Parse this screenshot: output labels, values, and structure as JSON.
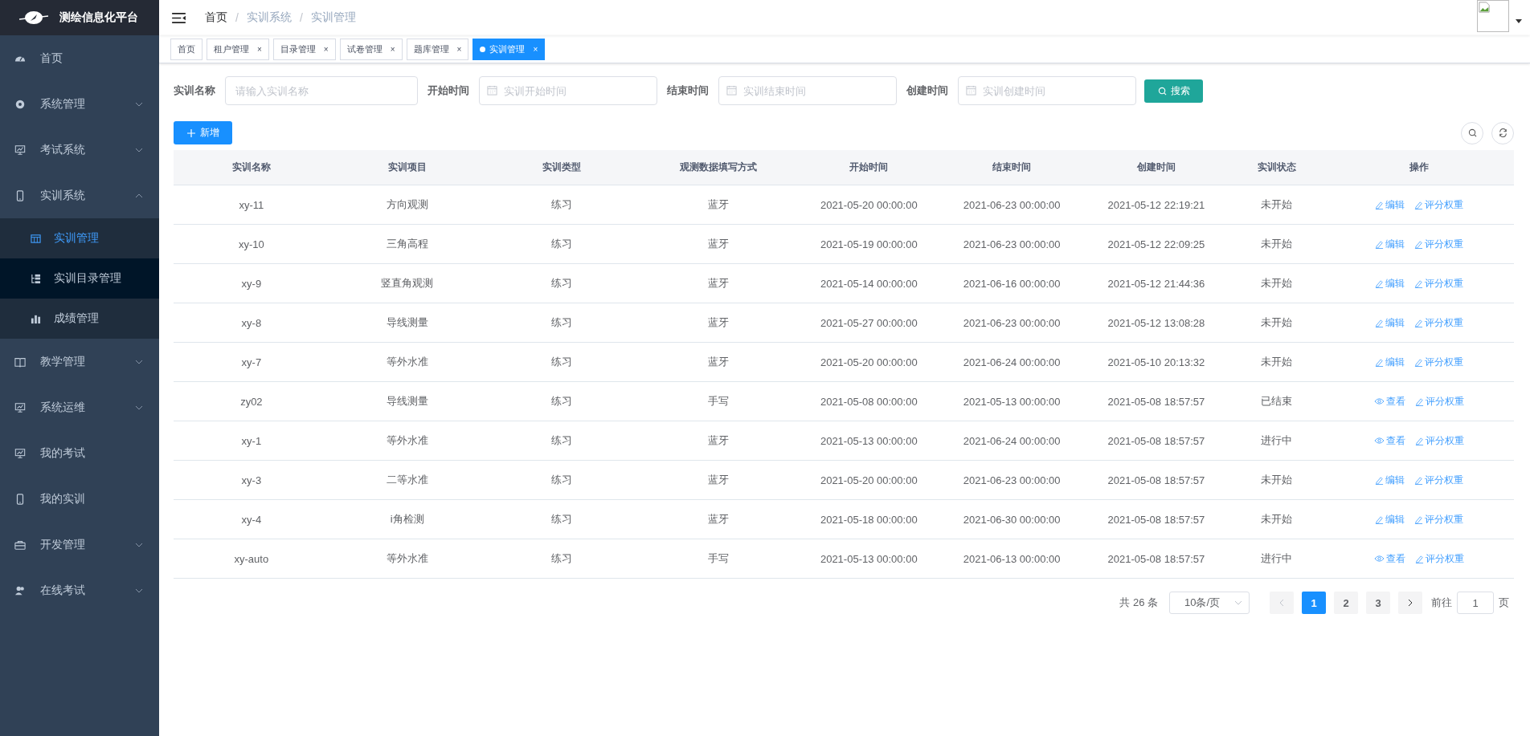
{
  "brand": {
    "title": "测绘信息化平台"
  },
  "sidebar": {
    "items": [
      {
        "label": "首页"
      },
      {
        "label": "系统管理",
        "expanded": false
      },
      {
        "label": "考试系统",
        "expanded": false
      },
      {
        "label": "实训系统",
        "expanded": true,
        "children": [
          {
            "label": "实训管理",
            "selected": true,
            "hovered": false
          },
          {
            "label": "实训目录管理",
            "selected": false,
            "hovered": true
          },
          {
            "label": "成绩管理",
            "selected": false,
            "hovered": false
          }
        ]
      },
      {
        "label": "教学管理",
        "expanded": false
      },
      {
        "label": "系统运维",
        "expanded": false
      },
      {
        "label": "我的考试"
      },
      {
        "label": "我的实训"
      },
      {
        "label": "开发管理",
        "expanded": false
      },
      {
        "label": "在线考试",
        "expanded": false
      }
    ]
  },
  "breadcrumb_separator": "/",
  "breadcrumb": [
    {
      "label": "首页",
      "current": true
    },
    {
      "label": "实训系统",
      "current": false
    },
    {
      "label": "实训管理",
      "current": false
    }
  ],
  "tabs": [
    {
      "label": "首页",
      "closable": false,
      "selected": false
    },
    {
      "label": "租户管理",
      "closable": true,
      "selected": false
    },
    {
      "label": "目录管理",
      "closable": true,
      "selected": false
    },
    {
      "label": "试卷管理",
      "closable": true,
      "selected": false
    },
    {
      "label": "题库管理",
      "closable": true,
      "selected": false
    },
    {
      "label": "实训管理",
      "closable": true,
      "selected": true
    }
  ],
  "close_mark": "×",
  "filters": [
    {
      "label": "实训名称",
      "placeholder": "请输入实训名称",
      "kind": "text"
    },
    {
      "label": "开始时间",
      "placeholder": "实训开始时间",
      "kind": "date"
    },
    {
      "label": "结束时间",
      "placeholder": "实训结束时间",
      "kind": "date"
    },
    {
      "label": "创建时间",
      "placeholder": "实训创建时间",
      "kind": "date"
    }
  ],
  "search_button": "搜索",
  "add_button": "新增",
  "table": {
    "columns": [
      "实训名称",
      "实训项目",
      "实训类型",
      "观测数据填写方式",
      "开始时间",
      "结束时间",
      "创建时间",
      "实训状态",
      "操作"
    ],
    "rows": [
      {
        "cells": [
          "xy-11",
          "方向观测",
          "练习",
          "蓝牙",
          "2021-05-20 00:00:00",
          "2021-06-23 00:00:00",
          "2021-05-12 22:19:21",
          "未开始"
        ],
        "actions": [
          {
            "kind": "edit",
            "label": "编辑"
          },
          {
            "kind": "edit",
            "label": "评分权重"
          }
        ]
      },
      {
        "cells": [
          "xy-10",
          "三角高程",
          "练习",
          "蓝牙",
          "2021-05-19 00:00:00",
          "2021-06-23 00:00:00",
          "2021-05-12 22:09:25",
          "未开始"
        ],
        "actions": [
          {
            "kind": "edit",
            "label": "编辑"
          },
          {
            "kind": "edit",
            "label": "评分权重"
          }
        ]
      },
      {
        "cells": [
          "xy-9",
          "竖直角观测",
          "练习",
          "蓝牙",
          "2021-05-14 00:00:00",
          "2021-06-16 00:00:00",
          "2021-05-12 21:44:36",
          "未开始"
        ],
        "actions": [
          {
            "kind": "edit",
            "label": "编辑"
          },
          {
            "kind": "edit",
            "label": "评分权重"
          }
        ]
      },
      {
        "cells": [
          "xy-8",
          "导线测量",
          "练习",
          "蓝牙",
          "2021-05-27 00:00:00",
          "2021-06-23 00:00:00",
          "2021-05-12 13:08:28",
          "未开始"
        ],
        "actions": [
          {
            "kind": "edit",
            "label": "编辑"
          },
          {
            "kind": "edit",
            "label": "评分权重"
          }
        ]
      },
      {
        "cells": [
          "xy-7",
          "等外水准",
          "练习",
          "蓝牙",
          "2021-05-20 00:00:00",
          "2021-06-24 00:00:00",
          "2021-05-10 20:13:32",
          "未开始"
        ],
        "actions": [
          {
            "kind": "edit",
            "label": "编辑"
          },
          {
            "kind": "edit",
            "label": "评分权重"
          }
        ]
      },
      {
        "cells": [
          "zy02",
          "导线测量",
          "练习",
          "手写",
          "2021-05-08 00:00:00",
          "2021-05-13 00:00:00",
          "2021-05-08 18:57:57",
          "已结束"
        ],
        "actions": [
          {
            "kind": "view",
            "label": "查看"
          },
          {
            "kind": "edit",
            "label": "评分权重"
          }
        ]
      },
      {
        "cells": [
          "xy-1",
          "等外水准",
          "练习",
          "蓝牙",
          "2021-05-13 00:00:00",
          "2021-06-24 00:00:00",
          "2021-05-08 18:57:57",
          "进行中"
        ],
        "actions": [
          {
            "kind": "view",
            "label": "查看"
          },
          {
            "kind": "edit",
            "label": "评分权重"
          }
        ]
      },
      {
        "cells": [
          "xy-3",
          "二等水准",
          "练习",
          "蓝牙",
          "2021-05-20 00:00:00",
          "2021-06-23 00:00:00",
          "2021-05-08 18:57:57",
          "未开始"
        ],
        "actions": [
          {
            "kind": "edit",
            "label": "编辑"
          },
          {
            "kind": "edit",
            "label": "评分权重"
          }
        ]
      },
      {
        "cells": [
          "xy-4",
          "i角检测",
          "练习",
          "蓝牙",
          "2021-05-18 00:00:00",
          "2021-06-30 00:00:00",
          "2021-05-08 18:57:57",
          "未开始"
        ],
        "actions": [
          {
            "kind": "edit",
            "label": "编辑"
          },
          {
            "kind": "edit",
            "label": "评分权重"
          }
        ]
      },
      {
        "cells": [
          "xy-auto",
          "等外水准",
          "练习",
          "手写",
          "2021-05-13 00:00:00",
          "2021-06-13 00:00:00",
          "2021-05-08 18:57:57",
          "进行中"
        ],
        "actions": [
          {
            "kind": "view",
            "label": "查看"
          },
          {
            "kind": "edit",
            "label": "评分权重"
          }
        ]
      }
    ]
  },
  "pagination": {
    "total": "共 26 条",
    "page_size": "10条/页",
    "prev_disabled": true,
    "next_disabled": false,
    "pages": [
      {
        "label": "1",
        "selected": true
      },
      {
        "label": "2",
        "selected": false
      },
      {
        "label": "3",
        "selected": false
      }
    ],
    "goto_label": "前往",
    "goto_value": "1",
    "goto_suffix": "页"
  }
}
